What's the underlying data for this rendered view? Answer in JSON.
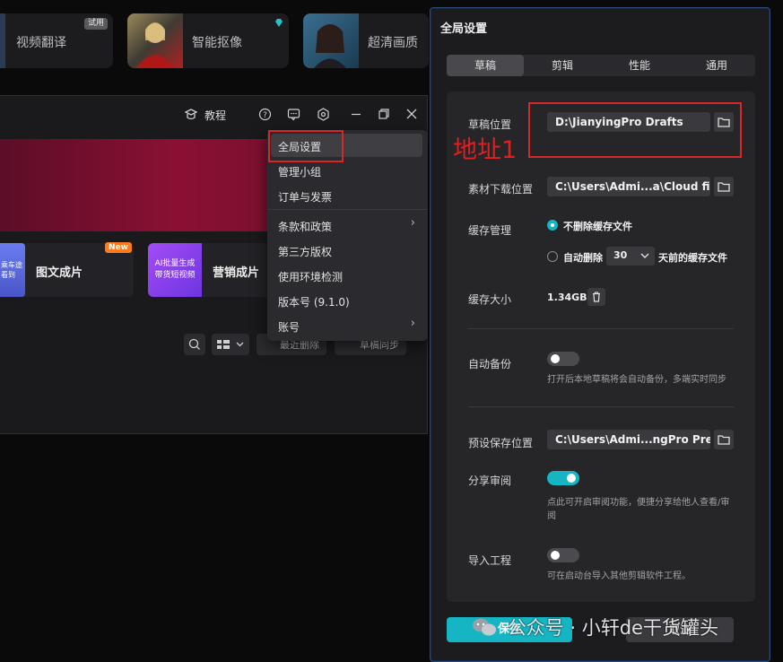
{
  "feature_cards": [
    {
      "label": "视频翻译",
      "badge": "试用"
    },
    {
      "label": "智能抠像"
    },
    {
      "label": "超清画质"
    }
  ],
  "toolbar": {
    "tutorial_label": "教程"
  },
  "templates": [
    {
      "label": "图文成片",
      "thumb_text": "乘车途\n看到",
      "badge": "New"
    },
    {
      "label": "营销成片",
      "thumb_text": "AI批量生成\n带货短视频"
    }
  ],
  "draft_actions": {
    "recent_delete": "最近删除",
    "draft_sync": "草稿同步"
  },
  "menu": {
    "items": [
      {
        "label": "全局设置",
        "highlighted": true
      },
      {
        "label": "管理小组"
      },
      {
        "label": "订单与发票"
      },
      {
        "label": "条款和政策",
        "submenu": true
      },
      {
        "label": "第三方版权"
      },
      {
        "label": "使用环境检测"
      },
      {
        "label": "版本号 (9.1.0)"
      },
      {
        "label": "账号",
        "submenu": true
      }
    ]
  },
  "annotation": {
    "address_note": "地址1"
  },
  "settings": {
    "title": "全局设置",
    "tabs": [
      "草稿",
      "剪辑",
      "性能",
      "通用"
    ],
    "active_tab": "草稿",
    "draft_location": {
      "label": "草稿位置",
      "value": "D:\\JianyingPro Drafts"
    },
    "material_download": {
      "label": "素材下载位置",
      "value": "C:\\Users\\Admi...a\\Cloud files"
    },
    "cache": {
      "label": "缓存管理",
      "option_keep": "不删除缓存文件",
      "option_auto": "自动删除",
      "days": "30",
      "days_suffix": "天前的缓存文件",
      "selected": "keep"
    },
    "cache_size": {
      "label": "缓存大小",
      "value": "1.34GB"
    },
    "auto_backup": {
      "label": "自动备份",
      "enabled": false,
      "hint": "打开后本地草稿将会自动备份，多端实时同步"
    },
    "preset_location": {
      "label": "预设保存位置",
      "value": "C:\\Users\\Admi...ngPro Presets"
    },
    "share_review": {
      "label": "分享审阅",
      "enabled": true,
      "hint_line1": "点此可开启审阅功能，便捷分享给他人查看/审",
      "hint_line2": "阅"
    },
    "import_project": {
      "label": "导入工程",
      "enabled": false,
      "hint": "可在启动台导入其他剪辑软件工程。"
    },
    "save_label": "保存",
    "cancel_label": "取消"
  },
  "watermark": "公众号 · 小轩de干货罐头",
  "colors": {
    "accent": "#16b5c3",
    "annotation": "#d62828"
  }
}
